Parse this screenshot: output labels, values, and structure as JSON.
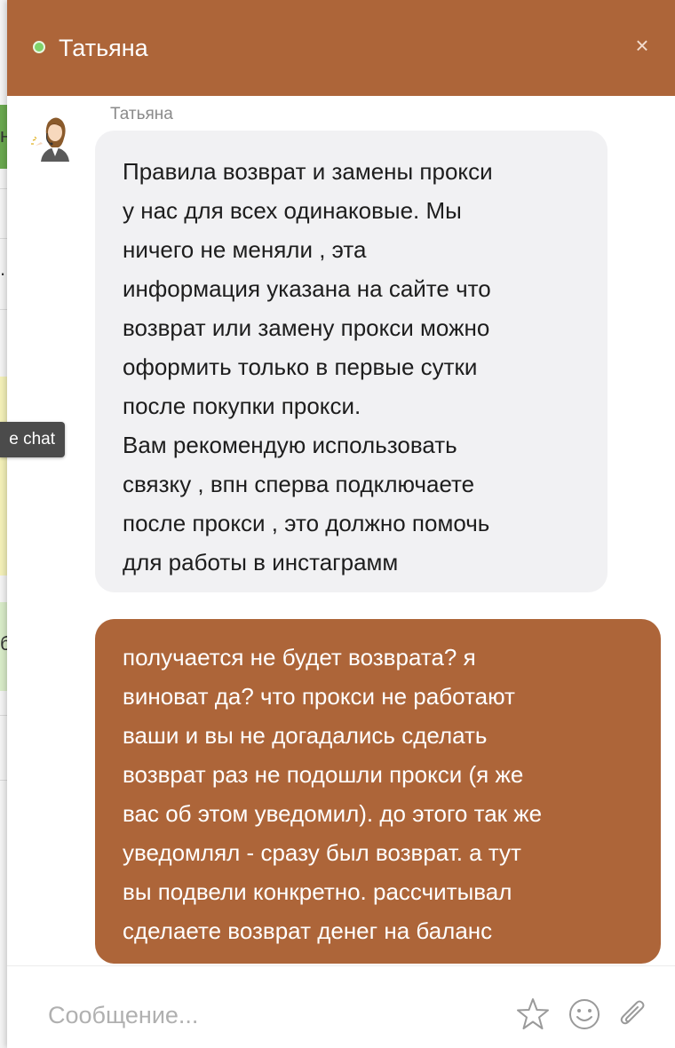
{
  "background": {
    "cut_chars": [
      "н",
      ".",
      "б"
    ]
  },
  "chat": {
    "header": {
      "title": "Татьяна",
      "status": "online",
      "close_label": "×",
      "accent_color": "#ad6539"
    },
    "messages": [
      {
        "direction": "incoming",
        "sender": "Татьяна",
        "avatar_icon": "operator-avatar-icon",
        "lines": [
          "Правила возврат и замены прокси",
          "у нас для всех одинаковые. Мы",
          "ничего не меняли , эта",
          "информация указана на сайте что",
          "возврат или замену прокси можно",
          "оформить только в первые сутки",
          "после покупки прокси.",
          "Вам рекомендую использовать",
          "связку , впн сперва подключаете",
          "после прокси , это должно помочь",
          "для работы в инстаграмм"
        ]
      },
      {
        "direction": "outgoing",
        "lines": [
          "получается не будет возврата? я",
          "виноват да? что прокси не работают",
          "ваши и вы не догадались сделать",
          "возврат раз не подошли прокси (я же",
          "вас об этом уведомил). до этого так же",
          "уведомлял - сразу был возврат. а тут",
          "вы подвели конкретно. рассчитывал",
          "сделаете возврат денег на баланс"
        ]
      }
    ],
    "composer": {
      "placeholder": "Сообщение...",
      "icons": [
        "star-icon",
        "smile-icon",
        "paperclip-icon"
      ]
    },
    "tooltip": "e chat"
  }
}
